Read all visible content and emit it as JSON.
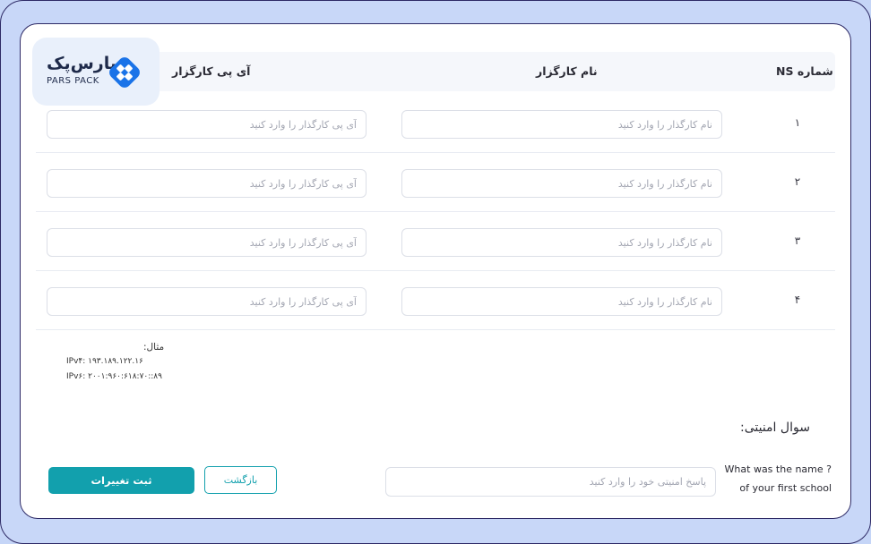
{
  "logo": {
    "fa": "پارس‌پک",
    "en": "PARS PACK",
    "brand_color": "#1e2a4a",
    "icon_color": "#1a73e8"
  },
  "table": {
    "headers": {
      "ns_number": "شماره NS",
      "server_name": "نام کارگزار",
      "server_ip": "آی پی کارگزار"
    },
    "rows": [
      {
        "number": "۱",
        "name_placeholder": "نام کارگذار را وارد کنید",
        "ip_placeholder": "آی پی کارگذار را وارد کنید"
      },
      {
        "number": "۲",
        "name_placeholder": "نام کارگذار را وارد کنید",
        "ip_placeholder": "آی پی کارگذار را وارد کنید"
      },
      {
        "number": "۳",
        "name_placeholder": "نام کارگذار را وارد کنید",
        "ip_placeholder": "آی پی کارگذار را وارد کنید"
      },
      {
        "number": "۴",
        "name_placeholder": "نام کارگذار را وارد کنید",
        "ip_placeholder": "آی پی کارگذار را وارد کنید"
      }
    ]
  },
  "example": {
    "label": "مثال:",
    "ipv4": "IPv۴: ۱۹۳.۱۸۹.۱۲۲.۱۶",
    "ipv6": "IPv۶: ۲۰۰۱:۹۶۰:۶۱۸:۷۰::۸۹"
  },
  "security": {
    "title": "سوال امنیتی:",
    "question": "What was the name ?of your first school",
    "answer_placeholder": "پاسخ امنیتی خود را وارد کنید"
  },
  "actions": {
    "save_label": "ثبت تغییرات",
    "back_label": "بازگشت",
    "accent_color": "#12a0ad"
  }
}
